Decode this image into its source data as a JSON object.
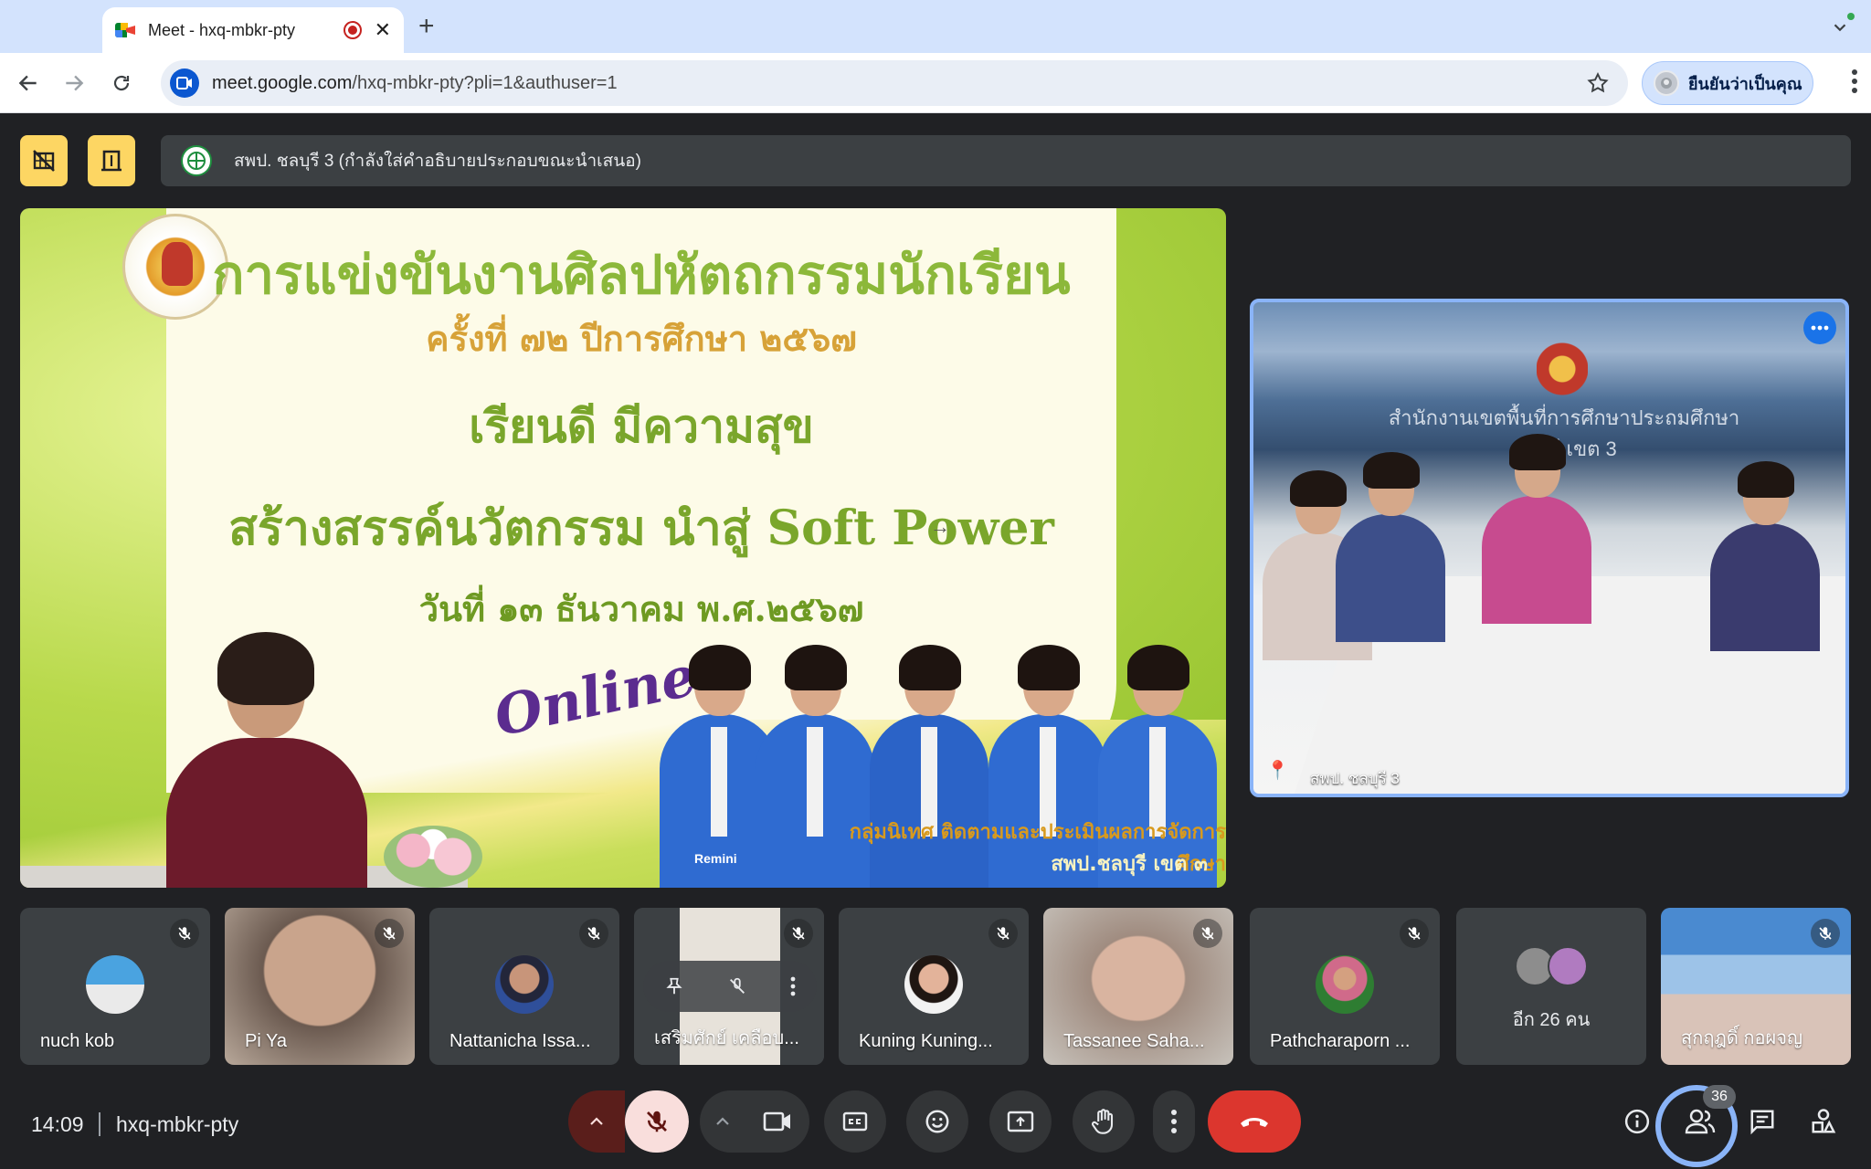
{
  "browser": {
    "tab_title": "Meet - hxq-mbkr-pty",
    "url_host": "meet.google.com",
    "url_path": "/hxq-mbkr-pty?pli=1&authuser=1",
    "profile_label": "ยืนยันว่าเป็นคุณ"
  },
  "caption": {
    "text": "สพป. ชลบุรี 3 (กำลังใส่คำอธิบายประกอบขณะนำเสนอ)"
  },
  "slide": {
    "line1": "การแข่งขันงานศิลปหัตถกรรมนักเรียน",
    "line2": "ครั้งที่ ๗๒ ปีการศึกษา ๒๕๖๗",
    "line3": "เรียนดี มีความสุข",
    "line4": "สร้างสรรค์นวัตกรรม นำสู่ Soft Power",
    "line5": "วันที่ ๑๓ ธันวาคม พ.ศ.๒๕๖๗",
    "online": "Online",
    "credit_line1": "กลุ่มนิเทศ ติดตามและประเมินผลการจัดการศึกษา",
    "credit_line2": "สพป.ชลบุรี เขต ๓",
    "watermark": "Remini"
  },
  "pinned": {
    "name": "สพป. ชลบุรี 3",
    "sign_line1": "สำนักงานเขตพื้นที่การศึกษาประถมศึกษา",
    "sign_line2": "ชลบุรี เขต 3"
  },
  "participants": [
    {
      "name": "nuch kob"
    },
    {
      "name": "Pi Ya"
    },
    {
      "name": "Nattanicha Issa..."
    },
    {
      "name": "เสริมศักย์ เคลือบ..."
    },
    {
      "name": "Kuning Kuning..."
    },
    {
      "name": "Tassanee Saha..."
    },
    {
      "name": "Pathcharaporn ..."
    },
    {
      "name": "อีก 26 คน"
    },
    {
      "name": "สุกฤฎดิ์ กอผจญ"
    }
  ],
  "controls": {
    "time": "14:09",
    "meeting_code": "hxq-mbkr-pty",
    "people_count": "36"
  },
  "colors": {
    "accent": "#8ab4f8",
    "leave": "#dc362e",
    "mic_off_bg": "#f9dedc",
    "host_controls": "#fdd663"
  }
}
